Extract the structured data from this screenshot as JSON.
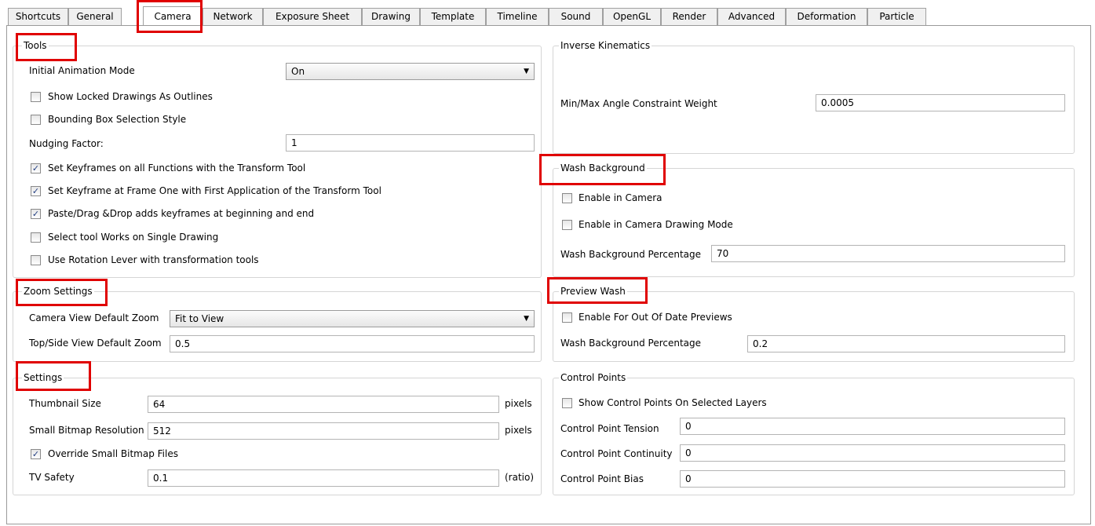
{
  "tabs": [
    "Shortcuts",
    "General",
    "Camera",
    "Network",
    "Exposure Sheet",
    "Drawing",
    "Template",
    "Timeline",
    "Sound",
    "OpenGL",
    "Render",
    "Advanced",
    "Deformation",
    "Particle"
  ],
  "active_tab": "Camera",
  "tools": {
    "title": "Tools",
    "initial_animation_mode_label": "Initial Animation Mode",
    "initial_animation_mode_value": "On",
    "show_locked_label": "Show Locked Drawings As Outlines",
    "bounding_box_label": "Bounding Box Selection Style",
    "nudging_label": "Nudging Factor:",
    "nudging_value": "1",
    "set_keyframes_all_label": "Set Keyframes on all Functions with the Transform Tool",
    "set_keyframe_first_label": "Set Keyframe at Frame One with First Application of the Transform Tool",
    "paste_drag_label": "Paste/Drag &Drop adds keyframes at beginning and end",
    "select_tool_label": "Select tool Works on Single Drawing",
    "rotation_lever_label": "Use Rotation Lever with transformation tools"
  },
  "zoom": {
    "title": "Zoom Settings",
    "camera_zoom_label": "Camera View Default Zoom",
    "camera_zoom_value": "Fit to View",
    "topside_zoom_label": "Top/Side View Default Zoom",
    "topside_zoom_value": "0.5"
  },
  "settings": {
    "title": "Settings",
    "thumb_label": "Thumbnail Size",
    "thumb_value": "64",
    "thumb_unit": "pixels",
    "bitmap_label": "Small Bitmap Resolution",
    "bitmap_value": "512",
    "bitmap_unit": "pixels",
    "override_label": "Override Small Bitmap Files",
    "tv_label": "TV Safety",
    "tv_value": "0.1",
    "tv_unit": "(ratio)"
  },
  "ik": {
    "title": "Inverse Kinematics",
    "angle_label": "Min/Max Angle Constraint Weight",
    "angle_value": "0.0005"
  },
  "wash": {
    "title": "Wash Background",
    "enable_camera_label": "Enable in Camera",
    "enable_drawing_label": "Enable in Camera Drawing Mode",
    "percent_label": "Wash Background Percentage",
    "percent_value": "70"
  },
  "preview_wash": {
    "title": "Preview Wash",
    "enable_label": "Enable For Out Of Date Previews",
    "percent_label": "Wash Background Percentage",
    "percent_value": "0.2"
  },
  "control_points": {
    "title": "Control Points",
    "show_label": "Show Control Points On Selected Layers",
    "tension_label": "Control Point Tension",
    "tension_value": "0",
    "continuity_label": "Control Point Continuity",
    "continuity_value": "0",
    "bias_label": "Control Point Bias",
    "bias_value": "0"
  },
  "check_glyph": "✓",
  "dropdown_glyph": "▼",
  "highlight_color": "#e00000"
}
